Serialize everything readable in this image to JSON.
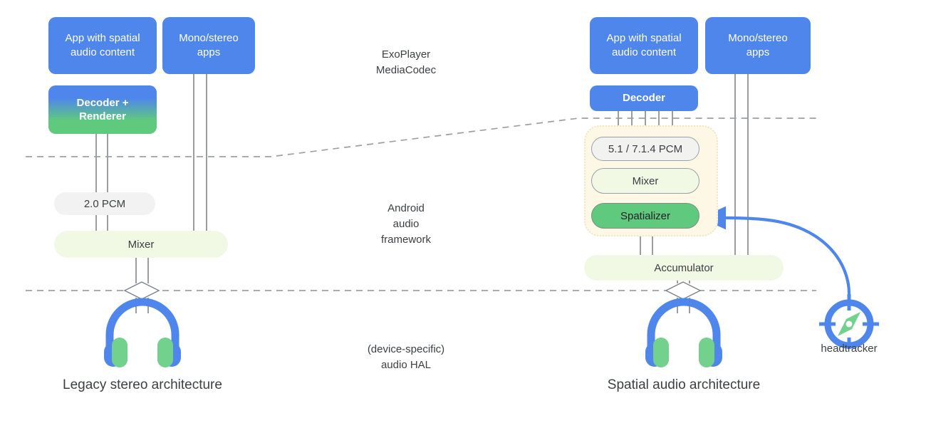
{
  "diagram": {
    "title": "Android spatial audio architecture comparison",
    "colors": {
      "blue": "#4F86EC",
      "green": "#5FC97E",
      "pill_green_bg": "#f1f8e4",
      "pill_gray_bg": "#f2f2f2",
      "cream_bg": "#fdf8e6",
      "cream_border": "#efe6c4",
      "line_gray": "#80868b",
      "dash_gray": "#9aa0a6",
      "text": "#3c4043",
      "arrow_blue": "#4F86EC"
    }
  },
  "left": {
    "caption": "Legacy stereo architecture",
    "app_spatial": "App with spatial\naudio content",
    "app_mono": "Mono/stereo\napps",
    "decoder_renderer": "Decoder +\nRenderer",
    "pcm": "2.0 PCM",
    "mixer": "Mixer",
    "headphones_icon": "headphones-icon"
  },
  "right": {
    "caption": "Spatial audio architecture",
    "app_spatial": "App with spatial\naudio content",
    "app_mono": "Mono/stereo\napps",
    "decoder": "Decoder",
    "pcm": "5.1 / 7.1.4 PCM",
    "mixer": "Mixer",
    "spatializer": "Spatializer",
    "accumulator": "Accumulator",
    "headphones_icon": "headphones-icon",
    "headtracker_label": "headtracker",
    "headtracker_icon": "compass-headtracker-icon"
  },
  "layers": {
    "top": "ExoPlayer\nMediaCodec",
    "middle": "Android\naudio\nframework",
    "bottom": "(device-specific)\naudio HAL"
  }
}
